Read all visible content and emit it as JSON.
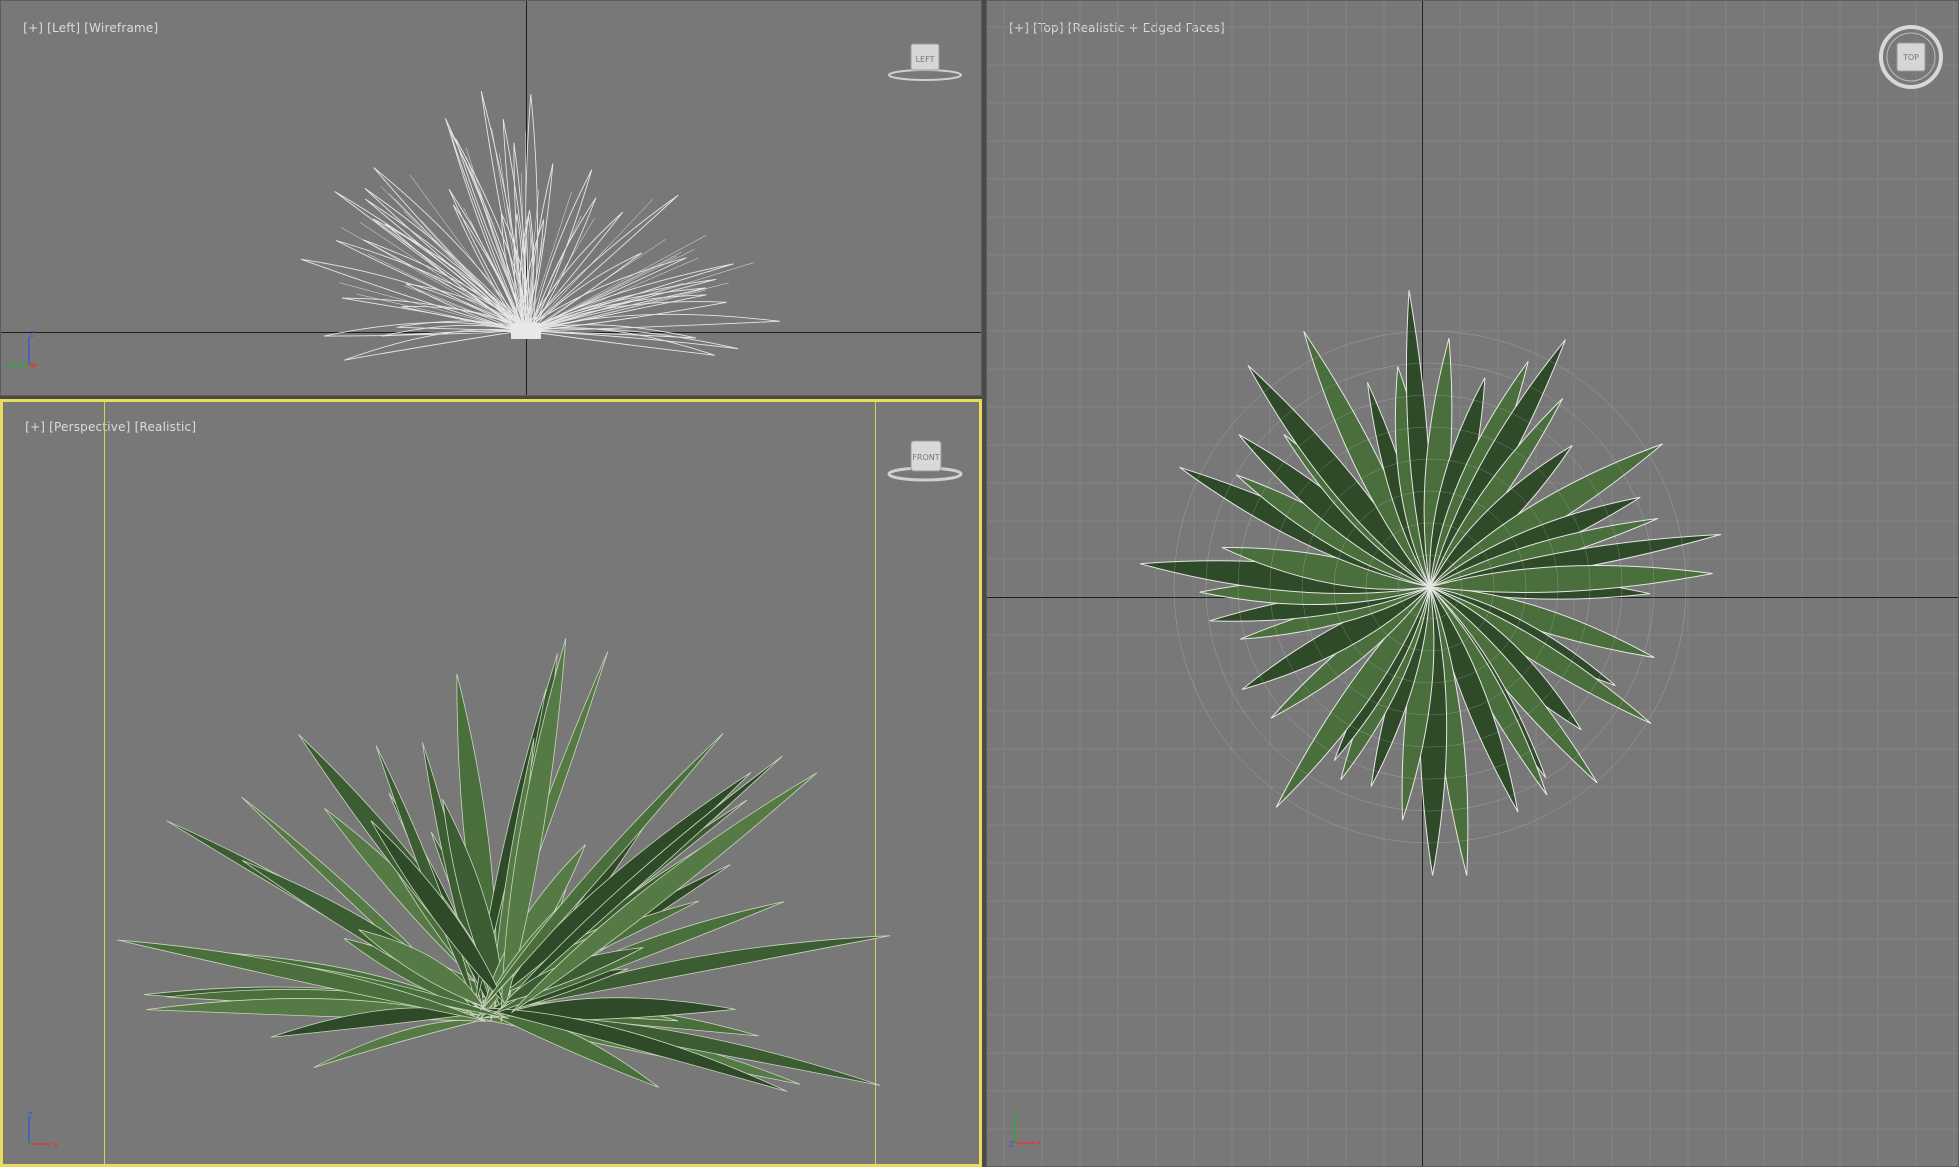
{
  "viewports": {
    "left": {
      "menu": "[+]",
      "view": "[Left]",
      "shading": "[Wireframe]",
      "viewcube": "LEFT",
      "axes": {
        "v": "Z",
        "h": "X",
        "d": "Y"
      }
    },
    "top": {
      "menu": "[+]",
      "view": "[Top]",
      "shading": "[Realistic + Edged Faces]",
      "viewcube": "TOP",
      "axes": {
        "v": "Y",
        "h": "X",
        "d": "Z"
      }
    },
    "perspective": {
      "menu": "[+]",
      "view": "[Perspective]",
      "shading": "[Realistic]",
      "viewcube": "FRONT",
      "axes": {
        "v": "Z",
        "h": "X",
        "d": "Y"
      }
    }
  },
  "colors": {
    "viewport_bg": "#787878",
    "active_border": "#e8dc5a",
    "leaf_dark": "#2f4a28",
    "leaf_mid": "#4a6e3c",
    "wire": "#e6e6e6"
  },
  "icons": {
    "viewcube": "viewcube-icon",
    "steering_wheel": "compass-ring-icon",
    "axis_tripod": "axis-tripod-icon"
  }
}
